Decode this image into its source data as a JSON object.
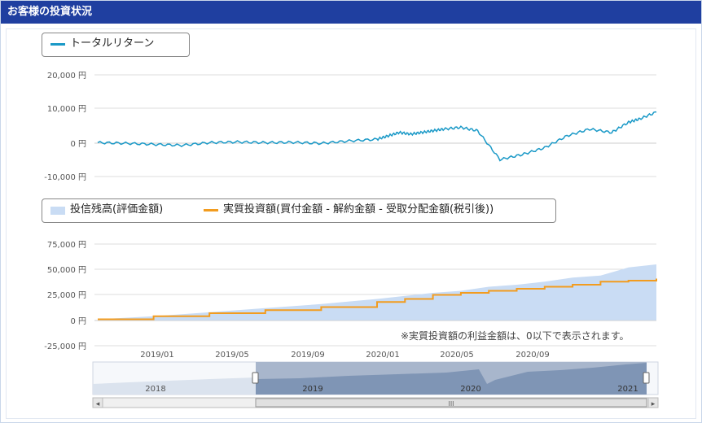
{
  "panel": {
    "title": "お客様の投資状況"
  },
  "legend_top": {
    "label": "トータルリターン",
    "color": "#1a99c7"
  },
  "legend_bottom": {
    "items": [
      {
        "label": "投信残高(評価金額)",
        "color": "#c9dcf4"
      },
      {
        "label": "実質投資額(買付金額 - 解約金額 - 受取分配金額(税引後))",
        "color": "#f29c1f"
      }
    ]
  },
  "note": "※実質投資額の利益金額は、0以下で表示されます。",
  "navigator": {
    "year_labels": [
      "2018",
      "2019",
      "2020",
      "2021"
    ],
    "scroll_grip": "III",
    "left_arrow": "◂",
    "right_arrow": "▸"
  },
  "chart_data": [
    {
      "type": "line",
      "name": "total-return",
      "yticks": [
        "20,000 円",
        "10,000 円",
        "0 円",
        "-10,000 円"
      ],
      "ylim": [
        -10000,
        20000
      ],
      "series": [
        {
          "name": "トータルリターン",
          "color": "#1a99c7",
          "x": [
            0,
            0.05,
            0.1,
            0.15,
            0.2,
            0.25,
            0.3,
            0.35,
            0.4,
            0.45,
            0.5,
            0.52,
            0.54,
            0.56,
            0.58,
            0.6,
            0.62,
            0.65,
            0.68,
            0.72,
            0.76,
            0.8,
            0.84,
            0.88,
            0.92,
            0.95,
            0.97,
            1.0
          ],
          "y": [
            0,
            -200,
            -500,
            -800,
            0,
            200,
            0,
            100,
            -200,
            500,
            1000,
            2000,
            3000,
            2500,
            3000,
            3500,
            4000,
            4500,
            3500,
            -5000,
            -3500,
            -1500,
            2000,
            4000,
            3000,
            6000,
            7000,
            9000
          ]
        }
      ]
    },
    {
      "type": "area",
      "name": "investment-balance",
      "yticks": [
        "75,000 円",
        "50,000 円",
        "25,000 円",
        "0 円",
        "-25,000 円"
      ],
      "ylim": [
        -25000,
        75000
      ],
      "categories": [
        "2019/01",
        "2019/05",
        "2019/09",
        "2020/01",
        "2020/05",
        "2020/09"
      ],
      "series": [
        {
          "name": "投信残高(評価金額)",
          "color": "#c9dcf4",
          "x": [
            0,
            0.1,
            0.2,
            0.3,
            0.4,
            0.5,
            0.55,
            0.6,
            0.65,
            0.7,
            0.75,
            0.8,
            0.85,
            0.9,
            0.95,
            1.0
          ],
          "y": [
            1000,
            4000,
            8000,
            12000,
            16000,
            21000,
            24000,
            27000,
            29000,
            33000,
            35000,
            38000,
            42000,
            44000,
            52000,
            55000
          ]
        },
        {
          "name": "実質投資額(買付金額 - 解約金額 - 受取分配金額(税引後))",
          "color": "#f29c1f",
          "x": [
            0,
            0.1,
            0.2,
            0.3,
            0.4,
            0.5,
            0.55,
            0.6,
            0.65,
            0.7,
            0.75,
            0.8,
            0.85,
            0.9,
            0.95,
            1.0
          ],
          "y": [
            1000,
            4000,
            7000,
            10000,
            13000,
            18000,
            21000,
            25000,
            27000,
            29000,
            31000,
            33000,
            35000,
            38000,
            39000,
            41000
          ]
        }
      ]
    }
  ]
}
